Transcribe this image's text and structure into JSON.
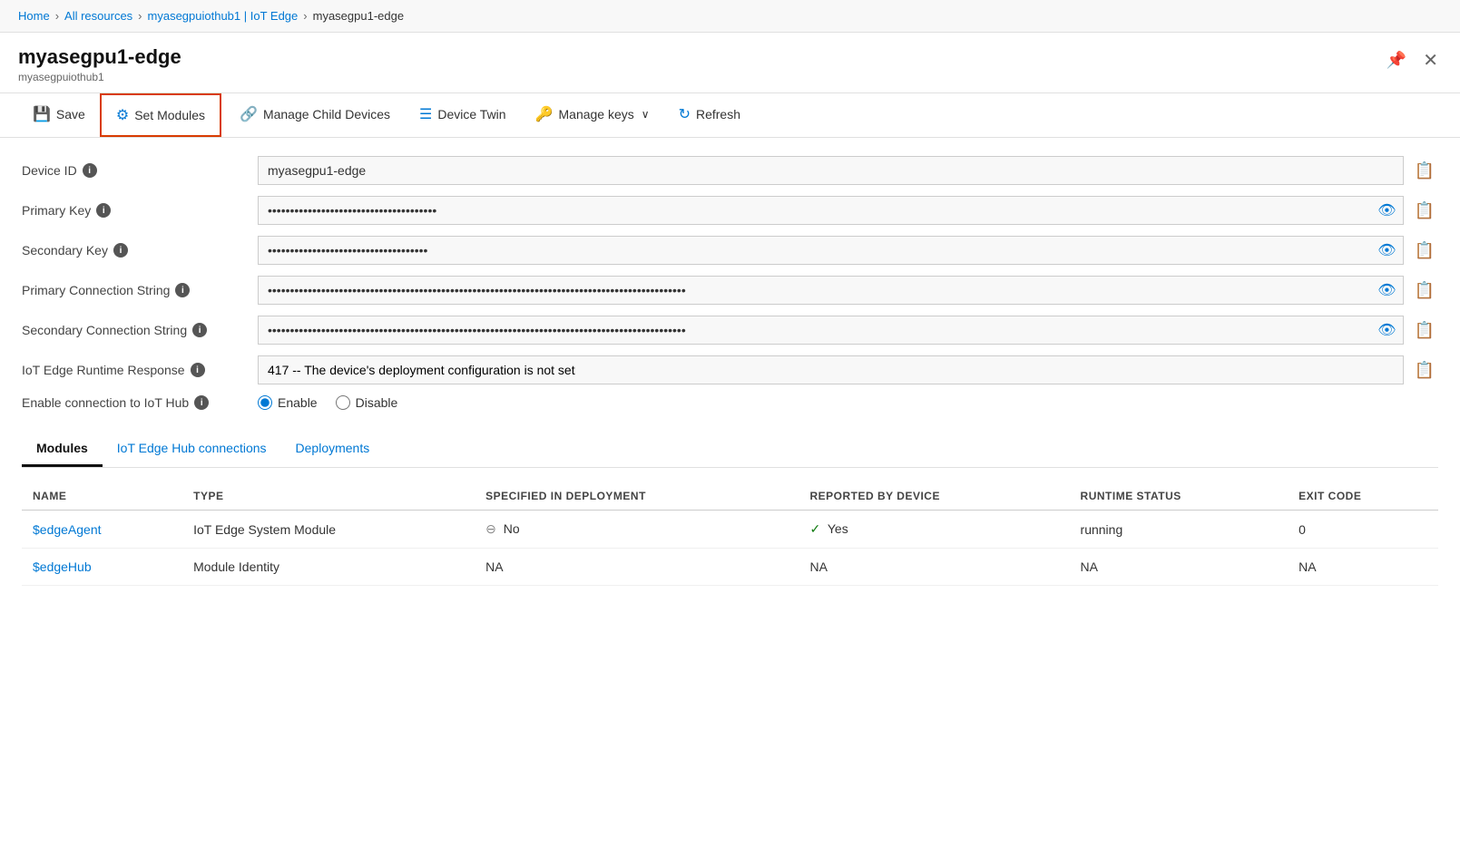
{
  "breadcrumb": {
    "items": [
      "Home",
      "All resources",
      "myasegpuiothub1 | IoT Edge",
      "myasegpu1-edge"
    ]
  },
  "header": {
    "title": "myasegpu1-edge",
    "subtitle": "myasegpuiothub1"
  },
  "toolbar": {
    "save_label": "Save",
    "set_modules_label": "Set Modules",
    "manage_child_label": "Manage Child Devices",
    "device_twin_label": "Device Twin",
    "manage_keys_label": "Manage keys",
    "refresh_label": "Refresh"
  },
  "form": {
    "device_id_label": "Device ID",
    "device_id_value": "myasegpu1-edge",
    "primary_key_label": "Primary Key",
    "primary_key_value": "••••••••••••••••••••••••••••••••••••••",
    "secondary_key_label": "Secondary Key",
    "secondary_key_value": "••••••••••••••••••••••••••••••••••••",
    "primary_conn_label": "Primary Connection String",
    "primary_conn_value": "••••••••••••••••••••••••••••••••••••••••••••••••••••••••••••••••••••••••••••••••••••••••••••••",
    "secondary_conn_label": "Secondary Connection String",
    "secondary_conn_value": "••••••••••••••••••••••••••••••••••••••••••••••••••••••••••••••••••••••••••••••••••••••••••••••",
    "iot_edge_runtime_label": "IoT Edge Runtime Response",
    "iot_edge_runtime_value": "417 -- The device's deployment configuration is not set",
    "enable_conn_label": "Enable connection to IoT Hub",
    "enable_label": "Enable",
    "disable_label": "Disable"
  },
  "tabs": {
    "items": [
      "Modules",
      "IoT Edge Hub connections",
      "Deployments"
    ],
    "active": 0
  },
  "table": {
    "columns": [
      "NAME",
      "TYPE",
      "SPECIFIED IN DEPLOYMENT",
      "REPORTED BY DEVICE",
      "RUNTIME STATUS",
      "EXIT CODE"
    ],
    "rows": [
      {
        "name": "$edgeAgent",
        "type": "IoT Edge System Module",
        "specified": "No",
        "reported": "Yes",
        "runtime_status": "running",
        "exit_code": "0"
      },
      {
        "name": "$edgeHub",
        "type": "Module Identity",
        "specified": "NA",
        "reported": "NA",
        "runtime_status": "NA",
        "exit_code": "NA"
      }
    ]
  },
  "icons": {
    "save": "💾",
    "set_modules": "⚙",
    "manage_child": "🔗",
    "device_twin": "☰",
    "manage_keys": "🔑",
    "refresh": "↻",
    "eye": "👁",
    "copy": "📋",
    "info": "i",
    "pin": "📌",
    "close": "✕",
    "chevron_down": "∨",
    "check": "✓",
    "minus": "⊖"
  }
}
